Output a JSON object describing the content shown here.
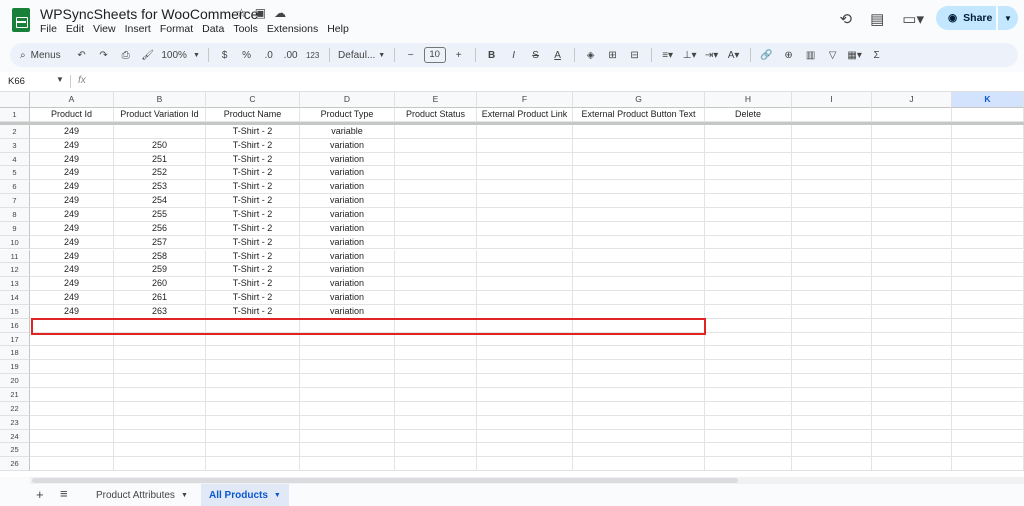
{
  "app": {
    "title": "WPSyncSheets for WooCommerce",
    "menu": [
      "File",
      "Edit",
      "View",
      "Insert",
      "Format",
      "Data",
      "Tools",
      "Extensions",
      "Help"
    ],
    "share_label": "Share"
  },
  "toolbar": {
    "menus_label": "Menus",
    "zoom": "100%",
    "currency": "$",
    "percent": "%",
    "dec_decrease": ".0",
    "dec_increase": ".00",
    "number_format": "123",
    "font": "Defaul...",
    "font_size": "10",
    "minus": "−",
    "plus": "+",
    "bold": "B",
    "italic": "I",
    "strike": "S",
    "text_color": "A",
    "sigma": "Σ"
  },
  "formula_bar": {
    "cell_ref": "K66",
    "fx": "fx",
    "content": ""
  },
  "grid": {
    "columns": [
      "A",
      "B",
      "C",
      "D",
      "E",
      "F",
      "G",
      "H",
      "I",
      "J",
      "K"
    ],
    "selected_column": "K",
    "header_row": [
      "Product Id",
      "Product Variation Id",
      "Product Name",
      "Product Type",
      "Product Status",
      "External Product Link",
      "External Product Button Text",
      "Delete",
      "",
      "",
      ""
    ],
    "rows": [
      [
        "249",
        "",
        "T-Shirt - 2",
        "variable"
      ],
      [
        "249",
        "250",
        "T-Shirt - 2",
        "variation"
      ],
      [
        "249",
        "251",
        "T-Shirt - 2",
        "variation"
      ],
      [
        "249",
        "252",
        "T-Shirt - 2",
        "variation"
      ],
      [
        "249",
        "253",
        "T-Shirt - 2",
        "variation"
      ],
      [
        "249",
        "254",
        "T-Shirt - 2",
        "variation"
      ],
      [
        "249",
        "255",
        "T-Shirt - 2",
        "variation"
      ],
      [
        "249",
        "256",
        "T-Shirt - 2",
        "variation"
      ],
      [
        "249",
        "257",
        "T-Shirt - 2",
        "variation"
      ],
      [
        "249",
        "258",
        "T-Shirt - 2",
        "variation"
      ],
      [
        "249",
        "259",
        "T-Shirt - 2",
        "variation"
      ],
      [
        "249",
        "260",
        "T-Shirt - 2",
        "variation"
      ],
      [
        "249",
        "261",
        "T-Shirt - 2",
        "variation"
      ],
      [
        "249",
        "263",
        "T-Shirt - 2",
        "variation"
      ]
    ],
    "row_numbers": [
      "1",
      "2",
      "3",
      "4",
      "5",
      "6",
      "7",
      "8",
      "9",
      "10",
      "11",
      "12",
      "13",
      "14",
      "15",
      "16",
      "17",
      "18",
      "19",
      "20",
      "21",
      "22",
      "23",
      "24",
      "25",
      "26"
    ],
    "highlight_row": "16"
  },
  "sheets": {
    "tabs": [
      {
        "label": "Product Attributes",
        "active": false
      },
      {
        "label": "All Products",
        "active": true
      }
    ]
  }
}
